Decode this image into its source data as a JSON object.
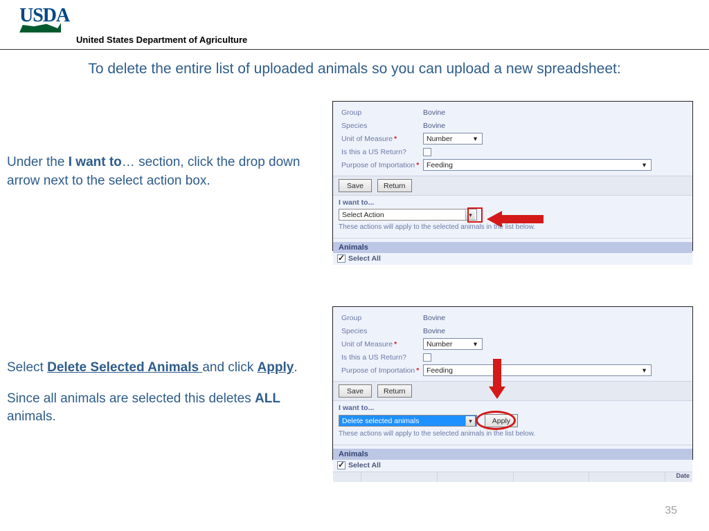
{
  "header": {
    "logo_text": "USDA",
    "department": "United States Department of Agriculture"
  },
  "main_heading": "To delete the entire list of uploaded animals so you can upload a new spreadsheet:",
  "step1": {
    "text_pre": "Under the ",
    "bold1": "I want to",
    "text_post": "… section, click the drop down arrow next to the select action box."
  },
  "step2": {
    "line1_pre": "Select ",
    "line1_und1": "Delete Selected Animals ",
    "line1_mid": "and click ",
    "line1_und2": "Apply",
    "line1_end": ".",
    "line2_pre": "Since all animals are selected this deletes ",
    "line2_bold": "ALL",
    "line2_post": " animals."
  },
  "shot": {
    "fields": {
      "group_label": "Group",
      "group_value": "Bovine",
      "species_label": "Species",
      "species_value": "Bovine",
      "uom_label": "Unit of Measure",
      "uom_value": "Number",
      "usreturn_label": "Is this a US Return?",
      "purpose_label": "Purpose of Importation",
      "purpose_value": "Feeding"
    },
    "buttons": {
      "save": "Save",
      "return": "Return",
      "apply": "Apply"
    },
    "wantto": {
      "legend": "I want to...",
      "select_action": "Select Action",
      "delete_selected": "Delete selected animals",
      "note": "These actions will apply to the selected animals in the list below."
    },
    "animals": {
      "header": "Animals",
      "select_all": "Select All",
      "date_col": "Date"
    }
  },
  "page_number": "35"
}
